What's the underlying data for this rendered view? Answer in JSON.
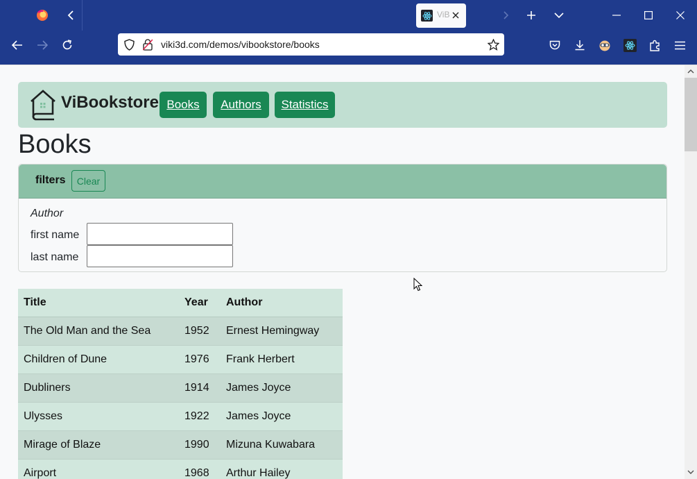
{
  "browser": {
    "tab_label": "ViBookstore",
    "url": "viki3d.com/demos/vibookstore/books"
  },
  "header": {
    "brand": "ViBookstore",
    "nav": [
      {
        "label": "Books"
      },
      {
        "label": "Authors"
      },
      {
        "label": "Statistics"
      }
    ]
  },
  "page": {
    "title": "Books"
  },
  "filters": {
    "label": "filters",
    "clear_label": "Clear",
    "author_group": "Author",
    "first_name_label": "first name",
    "first_name_value": "",
    "last_name_label": "last name",
    "last_name_value": ""
  },
  "table": {
    "headers": [
      "Title",
      "Year",
      "Author"
    ],
    "rows": [
      [
        "The Old Man and the Sea",
        "1952",
        "Ernest Hemingway"
      ],
      [
        "Children of Dune",
        "1976",
        "Frank Herbert"
      ],
      [
        "Dubliners",
        "1914",
        "James Joyce"
      ],
      [
        "Ulysses",
        "1922",
        "James Joyce"
      ],
      [
        "Mirage of Blaze",
        "1990",
        "Mizuna Kuwabara"
      ],
      [
        "Airport",
        "1968",
        "Arthur Hailey"
      ]
    ]
  },
  "colors": {
    "browser_chrome": "#1f3b8d",
    "header_bg": "#c1dfd2",
    "nav_button": "#198754",
    "filters_header": "#8bc0a6",
    "table_row_a": "#c7dbd2",
    "table_row_b": "#d1e7dd"
  },
  "icons": [
    "firefox-icon",
    "back-icon",
    "new-tab-icon",
    "list-tabs-icon",
    "minimize-icon",
    "maximize-icon",
    "close-icon",
    "reload-icon",
    "shield-icon",
    "lock-warning-icon",
    "bookmark-star-icon",
    "pocket-icon",
    "downloads-icon",
    "extension-icon",
    "react-devtools-icon",
    "puzzle-icon",
    "menu-icon",
    "house-book-logo-icon"
  ]
}
